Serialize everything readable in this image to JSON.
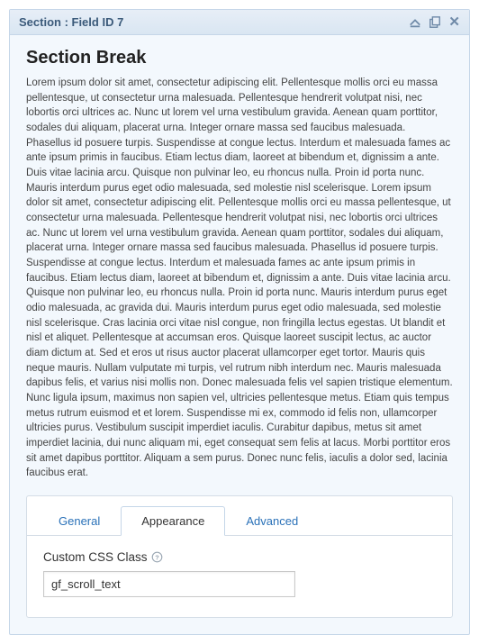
{
  "header": {
    "title": "Section : Field ID 7"
  },
  "section": {
    "title": "Section Break",
    "description": "Lorem ipsum dolor sit amet, consectetur adipiscing elit. Pellentesque mollis orci eu massa pellentesque, ut consectetur urna malesuada. Pellentesque hendrerit volutpat nisi, nec lobortis orci ultrices ac. Nunc ut lorem vel urna vestibulum gravida. Aenean quam porttitor, sodales dui aliquam, placerat urna. Integer ornare massa sed faucibus malesuada. Phasellus id posuere turpis. Suspendisse at congue lectus. Interdum et malesuada fames ac ante ipsum primis in faucibus. Etiam lectus diam, laoreet at bibendum et, dignissim a ante. Duis vitae lacinia arcu. Quisque non pulvinar leo, eu rhoncus nulla. Proin id porta nunc. Mauris interdum purus eget odio malesuada, sed molestie nisl scelerisque. Lorem ipsum dolor sit amet, consectetur adipiscing elit. Pellentesque mollis orci eu massa pellentesque, ut consectetur urna malesuada. Pellentesque hendrerit volutpat nisi, nec lobortis orci ultrices ac. Nunc ut lorem vel urna vestibulum gravida. Aenean quam porttitor, sodales dui aliquam, placerat urna. Integer ornare massa sed faucibus malesuada. Phasellus id posuere turpis. Suspendisse at congue lectus. Interdum et malesuada fames ac ante ipsum primis in faucibus. Etiam lectus diam, laoreet at bibendum et, dignissim a ante. Duis vitae lacinia arcu. Quisque non pulvinar leo, eu rhoncus nulla. Proin id porta nunc. Mauris interdum purus eget odio malesuada, ac gravida dui. Mauris interdum purus eget odio malesuada, sed molestie nisl scelerisque. Cras lacinia orci vitae nisl congue, non fringilla lectus egestas. Ut blandit et nisl et aliquet. Pellentesque at accumsan eros. Quisque laoreet suscipit lectus, ac auctor diam dictum at. Sed et eros ut risus auctor placerat ullamcorper eget tortor. Mauris quis neque mauris. Nullam vulputate mi turpis, vel rutrum nibh interdum nec. Mauris malesuada dapibus felis, et varius nisi mollis non. Donec malesuada felis vel sapien tristique elementum. Nunc ligula ipsum, maximus non sapien vel, ultricies pellentesque metus. Etiam quis tempus metus rutrum euismod et et lorem. Suspendisse mi ex, commodo id felis non, ullamcorper ultricies purus. Vestibulum suscipit imperdiet iaculis. Curabitur dapibus, metus sit amet imperdiet lacinia, dui nunc aliquam mi, eget consequat sem felis at lacus. Morbi porttitor eros sit amet dapibus porttitor. Aliquam a sem purus. Donec nunc felis, iaculis a dolor sed, lacinia faucibus erat."
  },
  "tabs": {
    "general": "General",
    "appearance": "Appearance",
    "advanced": "Advanced"
  },
  "appearance": {
    "css_label": "Custom CSS Class",
    "css_value": "gf_scroll_text"
  }
}
